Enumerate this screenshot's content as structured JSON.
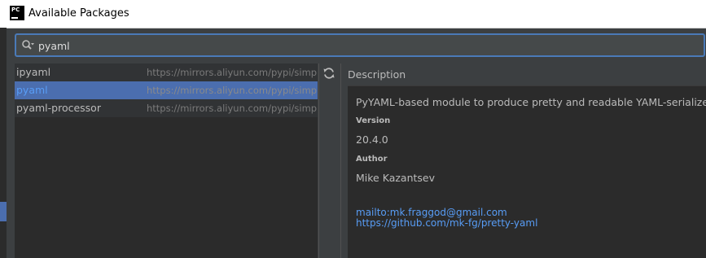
{
  "window": {
    "title": "Available Packages",
    "icon_text": "PC"
  },
  "search": {
    "value": "pyaml"
  },
  "packages": [
    {
      "name": "ipyaml",
      "url": "https://mirrors.aliyun.com/pypi/simple/",
      "selected": false
    },
    {
      "name": "pyaml",
      "url": "https://mirrors.aliyun.com/pypi/simple/",
      "selected": true
    },
    {
      "name": "pyaml-processor",
      "url": "https://mirrors.aliyun.com/pypi/simple/",
      "selected": false
    }
  ],
  "toolbar": {
    "refresh_icon": "refresh-icon"
  },
  "description": {
    "header": "Description",
    "summary": "PyYAML-based module to produce pretty and readable YAML-serialized data",
    "version_label": "Version",
    "version": "20.4.0",
    "author_label": "Author",
    "author": "Mike Kazantsev",
    "links": [
      "mailto:mk.fraggod@gmail.com",
      "https://github.com/mk-fg/pretty-yaml"
    ]
  },
  "colors": {
    "background": "#3c3f41",
    "panel": "#2b2b2b",
    "selection": "#4b6eaf",
    "link": "#589df6",
    "focus_border": "#4a7ab8"
  }
}
